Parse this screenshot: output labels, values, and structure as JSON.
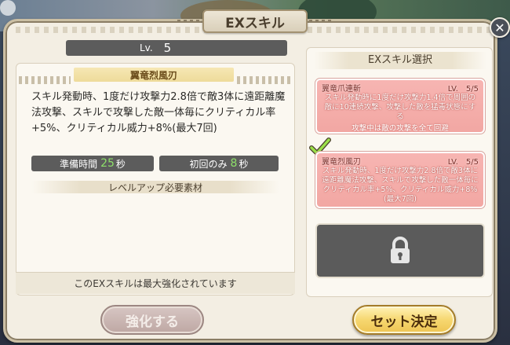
{
  "window": {
    "title": "EXスキル",
    "close_label": "✕"
  },
  "skill_detail": {
    "level_label": "Lv.",
    "level_value": "5",
    "skill_name": "翼竜烈風刃",
    "description": "スキル発動時、1度だけ攻撃力2.8倍で敵3体に遠距離魔法攻撃、スキルで攻撃した敵一体毎にクリティカル率+5%、クリティカル威力+8%(最大7回)",
    "prep_time_label": "準備時間",
    "prep_time_value": "25",
    "prep_time_unit": "秒",
    "first_only_label": "初回のみ",
    "first_only_value": "8",
    "first_only_unit": "秒",
    "materials_header": "レベルアップ必要素材",
    "maxed_note": "このEXスキルは最大強化されています"
  },
  "ex_select": {
    "header": "EXスキル選択",
    "options": [
      {
        "name": "翼竜爪連斬",
        "level": "LV.　5/5",
        "description": "スキル発動時に1度だけ攻撃力1.4倍で周囲の敵に10連続攻撃、攻撃した敵を猛毒状態にする",
        "sub": "攻撃中は敵の攻撃を全て回避",
        "selected": false
      },
      {
        "name": "翼竜烈風刃",
        "level": "LV.　5/5",
        "description": "スキル発動時、1度だけ攻撃力2.8倍で敵3体に遠距離魔法攻撃、スキルで攻撃した敵一体毎にクリティカル率+5%、クリティカル威力+8%(最大7回)",
        "selected": true
      }
    ],
    "locked_icon": "lock-icon"
  },
  "buttons": {
    "strengthen": "強化する",
    "confirm": "セット決定"
  },
  "colors": {
    "panel_bg": "#f3eee3",
    "option_bg": "#f2a7a3",
    "accent_green": "#8ee06a",
    "confirm_gold": "#f6d770"
  }
}
